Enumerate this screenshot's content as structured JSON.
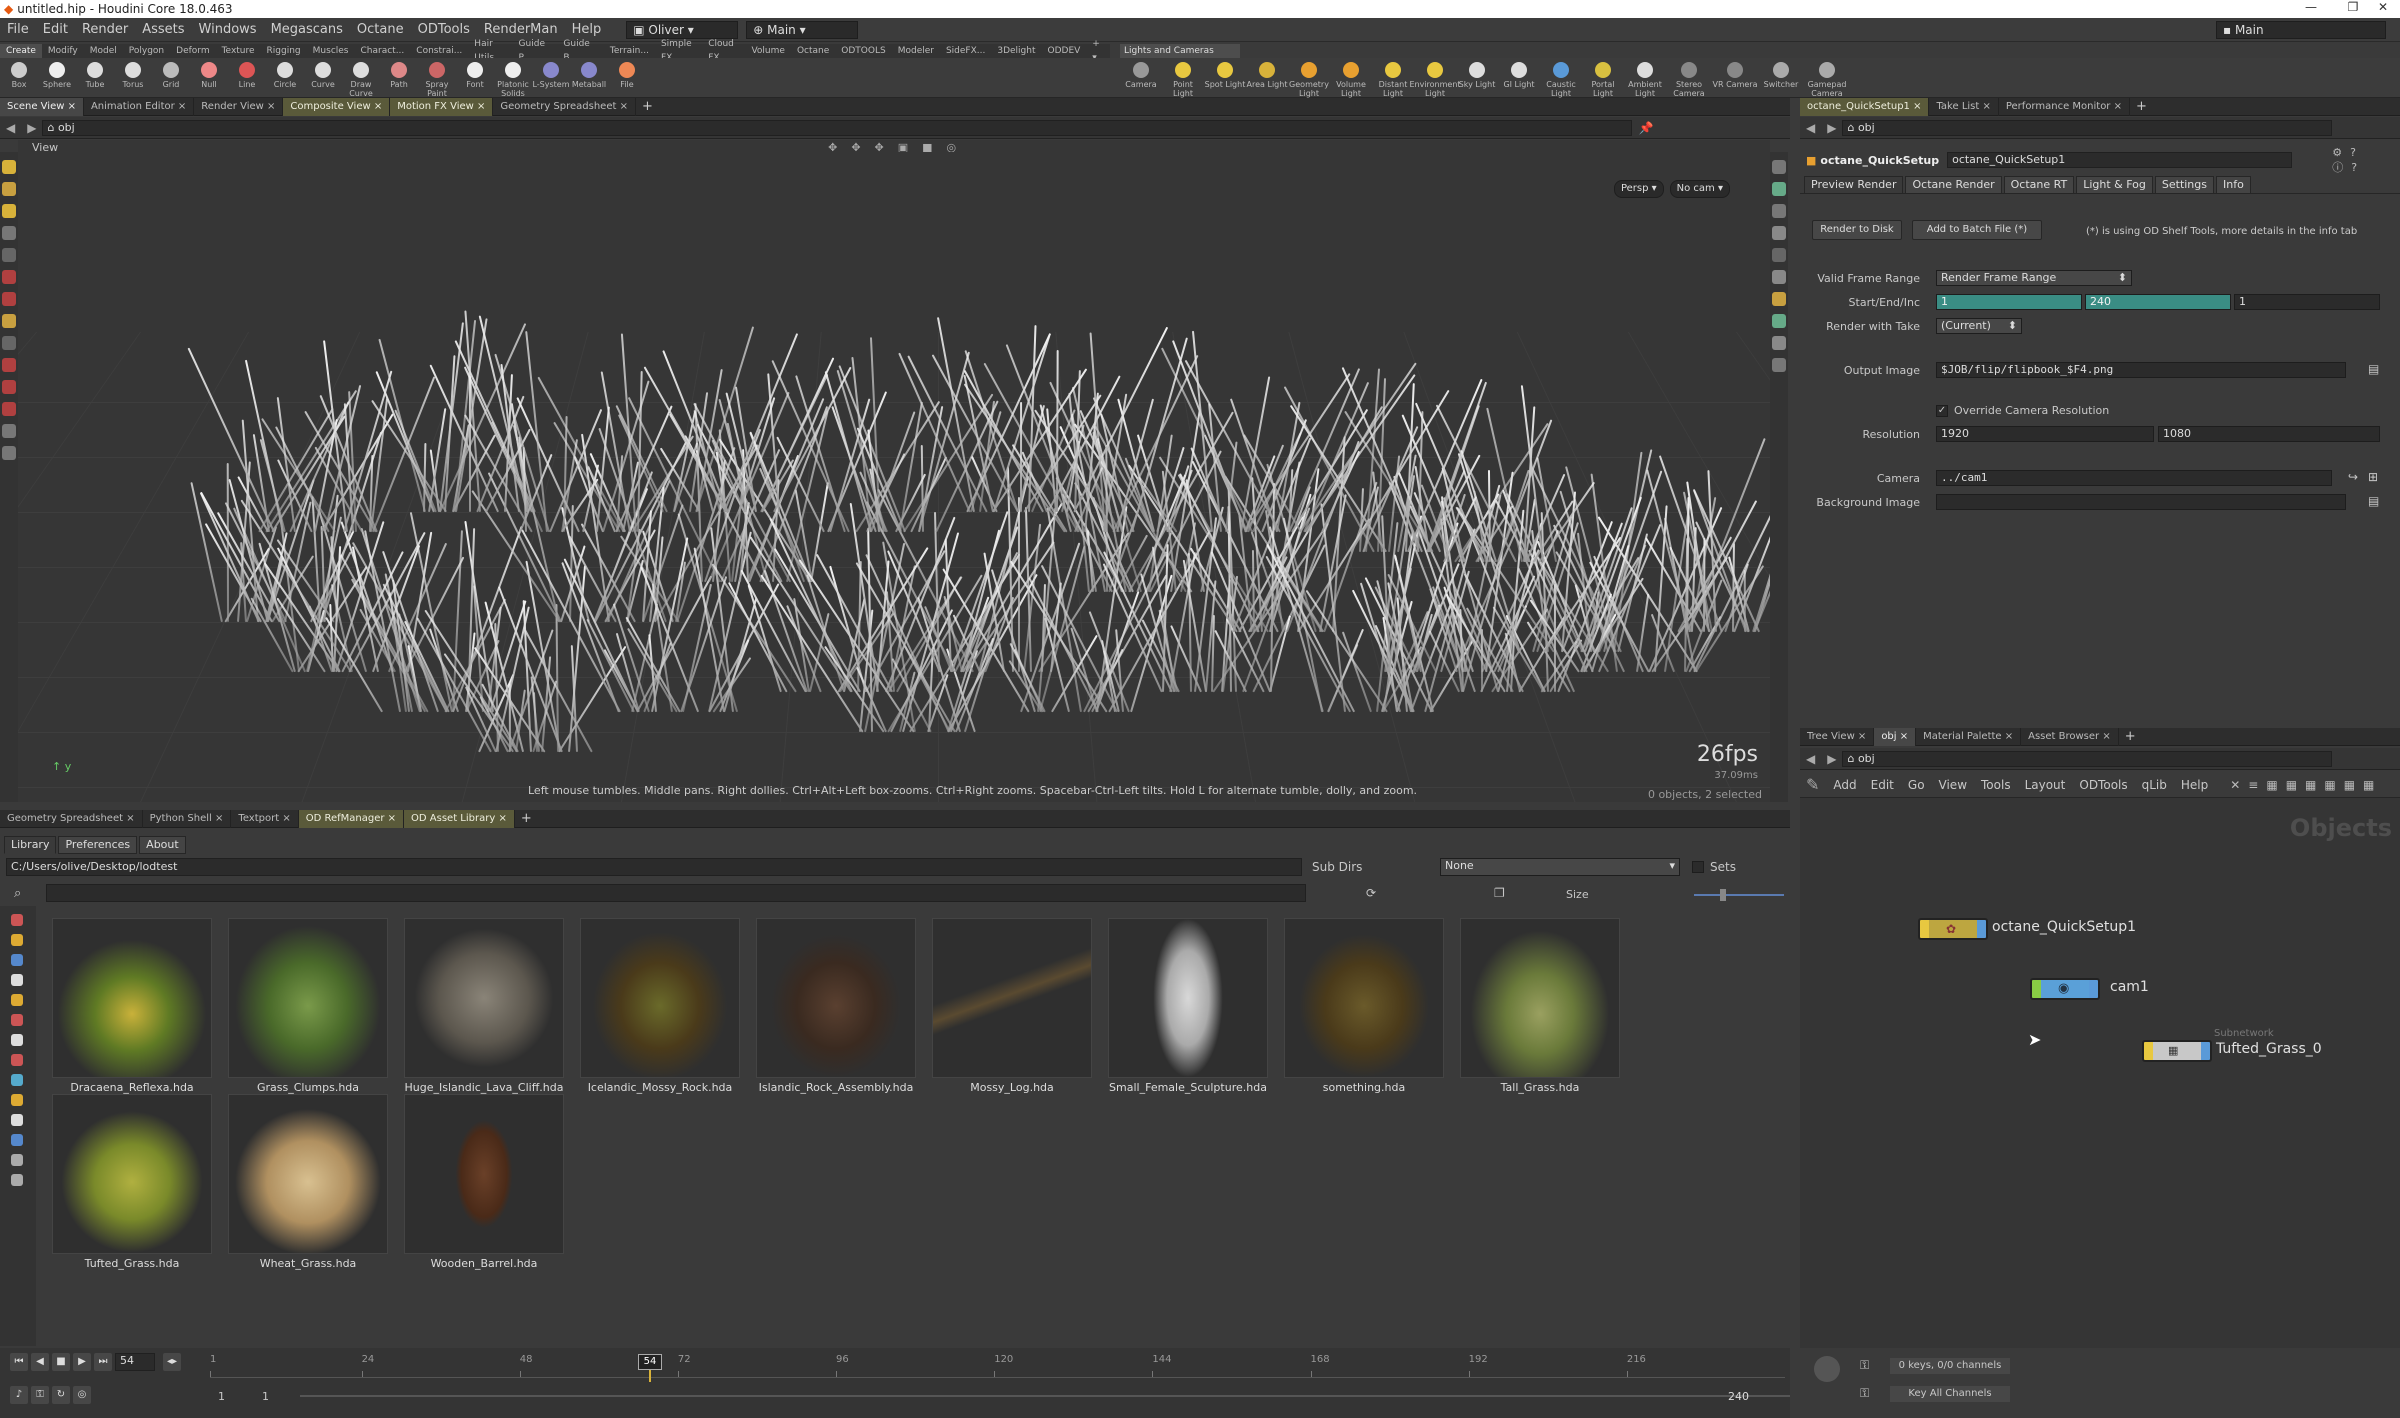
{
  "window": {
    "title": "untitled.hip - Houdini Core 18.0.463",
    "desktop_label": "Main"
  },
  "menu": [
    "File",
    "Edit",
    "Render",
    "Assets",
    "Windows",
    "Megascans",
    "Octane",
    "ODTools",
    "RenderMan",
    "Help"
  ],
  "menu_desktop": "Oliver",
  "menu_context": "Main",
  "shelf_tabs": [
    "Create",
    "Modify",
    "Model",
    "Polygon",
    "Deform",
    "Texture",
    "Rigging",
    "Muscles",
    "Charact...",
    "Constrai...",
    "Hair Utils",
    "Guide P...",
    "Guide B...",
    "Terrain...",
    "Simple FX",
    "Cloud FX",
    "Volume",
    "Octane",
    "ODTOOLS",
    "Modeler",
    "SideFX...",
    "3Delight",
    "ODDEV"
  ],
  "shelf_tools": [
    "Box",
    "Sphere",
    "Tube",
    "Torus",
    "Grid",
    "Null",
    "Line",
    "Circle",
    "Curve",
    "Draw Curve",
    "Path",
    "Spray Paint",
    "Font",
    "Platonic Solids",
    "L-System",
    "Metaball",
    "File"
  ],
  "light_shelf_tab": "Lights and Cameras",
  "light_tools": [
    "Camera",
    "Point Light",
    "Spot Light",
    "Area Light",
    "Geometry Light",
    "Volume Light",
    "Distant Light",
    "Environment Light",
    "Sky Light",
    "GI Light",
    "Caustic Light",
    "Portal Light",
    "Ambient Light",
    "Stereo Camera",
    "VR Camera",
    "Switcher",
    "Gamepad Camera"
  ],
  "viewport": {
    "tabs": [
      "Scene View",
      "Animation Editor",
      "Render View",
      "Composite View",
      "Motion FX View",
      "Geometry Spreadsheet"
    ],
    "path": "obj",
    "label": "View",
    "persp": "Persp",
    "cam": "No cam",
    "fps": "26fps",
    "ms": "37.09ms",
    "hint": "Left mouse tumbles. Middle pans. Right dollies. Ctrl+Alt+Left box-zooms. Ctrl+Right zooms. Spacebar-Ctrl-Left tilts. Hold L for alternate tumble, dolly, and zoom.",
    "status": "0 objects, 2 selected"
  },
  "params": {
    "tabs": [
      "octane_QuickSetup1",
      "Take List",
      "Performance Monitor"
    ],
    "path": "obj",
    "node_type": "octane_QuickSetup",
    "node_name": "octane_QuickSetup1",
    "subtabs": [
      "Preview Render",
      "Octane Render",
      "Octane RT",
      "Light & Fog",
      "Settings",
      "Info"
    ],
    "render_to_disk": "Render to Disk",
    "add_batch": "Add to Batch File (*)",
    "note": "(*) is using OD Shelf Tools, more details in the info tab",
    "valid_frame_range_label": "Valid Frame Range",
    "valid_frame_range": "Render Frame Range",
    "start_end_inc_label": "Start/End/Inc",
    "start": "1",
    "end": "240",
    "inc": "1",
    "render_with_take_label": "Render with Take",
    "render_with_take": "(Current)",
    "output_image_label": "Output Image",
    "output_image": "$JOB/flip/flipbook_$F4.png",
    "override_res": "Override Camera Resolution",
    "override_res_checked": true,
    "resolution_label": "Resolution",
    "res_x": "1920",
    "res_y": "1080",
    "camera_label": "Camera",
    "camera": "../cam1",
    "bg_image_label": "Background Image",
    "bg_image": ""
  },
  "network": {
    "tabs": [
      "Tree View",
      "obj",
      "Material Palette",
      "Asset Browser"
    ],
    "path": "obj",
    "menu": [
      "Add",
      "Edit",
      "Go",
      "View",
      "Tools",
      "Layout",
      "ODTools",
      "qLib",
      "Help"
    ],
    "context": "Objects",
    "nodes": [
      {
        "name": "octane_QuickSetup1",
        "color": "#e8c840"
      },
      {
        "name": "cam1",
        "color": "#5aa0d8"
      },
      {
        "name": "Tufted_Grass_0",
        "color": "#e8c840",
        "sub": "Subnetwork"
      }
    ]
  },
  "library": {
    "tabs": [
      "Geometry Spreadsheet",
      "Python Shell",
      "Textport",
      "OD RefManager",
      "OD Asset Library"
    ],
    "subtabs": [
      "Library",
      "Preferences",
      "About"
    ],
    "path": "C:/Users/olive/Desktop/lodtest",
    "subdirs": "Sub Dirs",
    "filter": "None",
    "sets": "Sets",
    "size_label": "Size",
    "assets": [
      "Dracaena_Reflexa.hda",
      "Grass_Clumps.hda",
      "Huge_Islandic_Lava_Cliff.hda",
      "Icelandic_Mossy_Rock.hda",
      "Islandic_Rock_Assembly.hda",
      "Mossy_Log.hda",
      "Small_Female_Sculpture.hda",
      "something.hda",
      "Tall_Grass.hda",
      "Tufted_Grass.hda",
      "Wheat_Grass.hda",
      "Wooden_Barrel.hda"
    ]
  },
  "timeline": {
    "current_frame": "54",
    "ticks": [
      "1",
      "24",
      "48",
      "72",
      "96",
      "120",
      "144",
      "168",
      "192",
      "216"
    ],
    "marker": "54",
    "range_start": "1",
    "range_start2": "1",
    "range_end": "240",
    "range_end2": "240",
    "keys": "0 keys, 0/0 channels",
    "key_all": "Key All Channels"
  }
}
